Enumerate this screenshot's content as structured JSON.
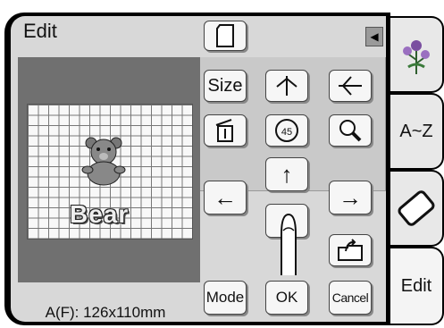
{
  "screen": {
    "title": "Edit",
    "pattern_text": "Bear",
    "size_readout": "A(F): 126x110mm"
  },
  "buttons": {
    "size_label": "Size",
    "rotate_label": "45",
    "mode_label": "Mode",
    "ok_label": "OK",
    "cancel_label": "Cancel"
  },
  "tabs": {
    "az_label": "A~Z",
    "edit_label": "Edit"
  }
}
